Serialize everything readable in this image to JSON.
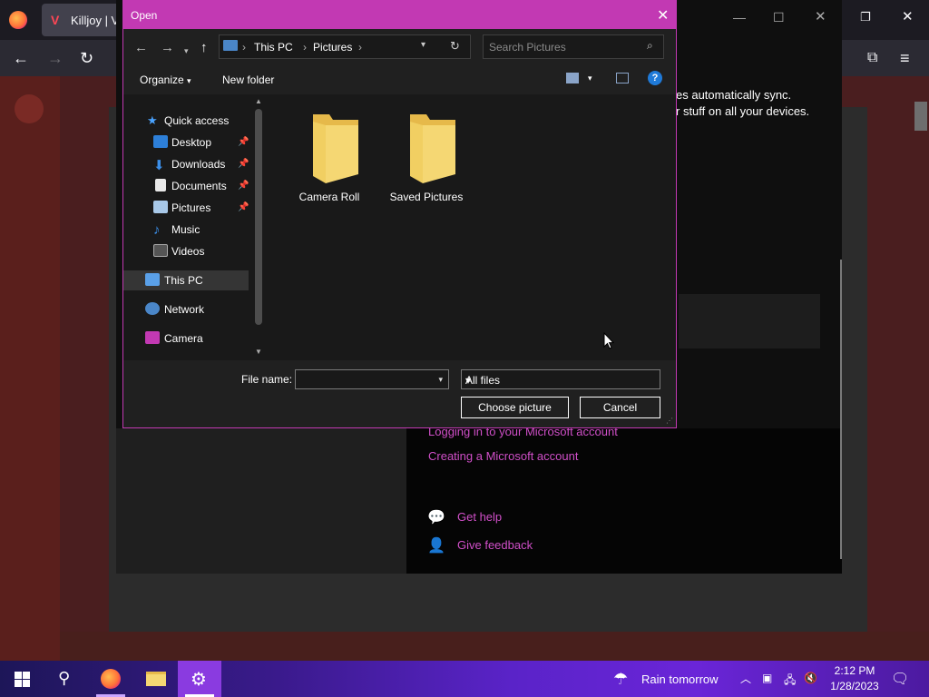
{
  "browser": {
    "tab_title": "Killjoy | Va"
  },
  "settings_window": {
    "sync_text_line1": "es automatically sync.",
    "sync_text_line2": "r stuff on all your devices.",
    "link_login": "Logging in to your Microsoft account",
    "link_create": "Creating a Microsoft account",
    "get_help": "Get help",
    "give_feedback": "Give feedback"
  },
  "dialog": {
    "title": "Open",
    "breadcrumb": [
      "This PC",
      "Pictures"
    ],
    "search_placeholder": "Search Pictures",
    "organize_label": "Organize",
    "new_folder_label": "New folder",
    "nav_items": [
      {
        "label": "Quick access",
        "icon": "star-icon"
      },
      {
        "label": "Desktop",
        "icon": "desktop-icon",
        "pinned": true
      },
      {
        "label": "Downloads",
        "icon": "downloads-icon",
        "pinned": true
      },
      {
        "label": "Documents",
        "icon": "documents-icon",
        "pinned": true
      },
      {
        "label": "Pictures",
        "icon": "pictures-icon",
        "pinned": true
      },
      {
        "label": "Music",
        "icon": "music-icon"
      },
      {
        "label": "Videos",
        "icon": "videos-icon"
      },
      {
        "label": "This PC",
        "icon": "this-pc-icon",
        "selected": true
      },
      {
        "label": "Network",
        "icon": "network-icon"
      },
      {
        "label": "Camera",
        "icon": "camera-icon"
      }
    ],
    "folders": [
      "Camera Roll",
      "Saved Pictures"
    ],
    "file_name_label": "File name:",
    "file_name_value": "",
    "file_type": "All files",
    "choose_button": "Choose picture",
    "cancel_button": "Cancel"
  },
  "taskbar": {
    "weather": "Rain tomorrow",
    "time": "2:12 PM",
    "date": "1/28/2023"
  },
  "colors": {
    "accent": "#c239b3",
    "folder": "#f3d06b",
    "link": "#d04fc8"
  }
}
